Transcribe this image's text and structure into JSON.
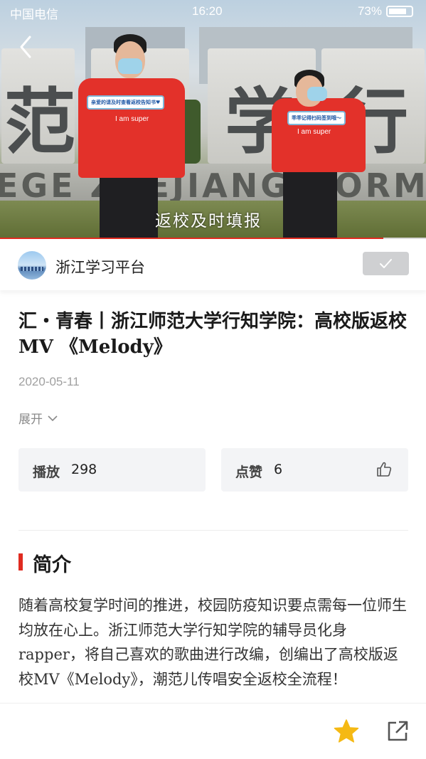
{
  "status_bar": {
    "carrier": "中国电信",
    "time": "16:20",
    "battery": "73%",
    "battery_level": 0.73
  },
  "video": {
    "caption": "返校及时填报",
    "plinth_text": "EGE ZHEJIANG NORMAL",
    "stone_glyphs": [
      "范",
      "学",
      "行"
    ],
    "person1_shirt": "I am super",
    "person1_sign": "亲爱的请及时查看返校告知书♥",
    "person2_shirt": "I am super",
    "person2_sign": "乖乖记得扫码签到哦～",
    "progress": 0.9
  },
  "channel": {
    "name": "浙江学习平台"
  },
  "article": {
    "title": "汇・青春丨浙江师范大学行知学院：高校版返校MV 《Melody》",
    "date": "2020-05-11",
    "expand_label": "展开",
    "plays_label": "播放",
    "plays_value": "298",
    "likes_label": "点赞",
    "likes_value": "6"
  },
  "intro": {
    "heading": "简介",
    "body": "随着高校复学时间的推进，校园防疫知识要点需每一位师生均放在心上。浙江师范大学行知学院的辅导员化身rapper，将自己喜欢的歌曲进行改编，创编出了高校版返校MV《Melody》，潮范儿传唱安全返校全流程！"
  },
  "colors": {
    "accent_red": "#e02b20",
    "star_yellow": "#f5b914",
    "stat_bg": "#f3f4f6"
  },
  "icons": [
    "back-arrow-icon",
    "wifi-icon",
    "battery-icon",
    "checkmark-icon",
    "chevron-down-icon",
    "thumbs-up-icon",
    "star-icon",
    "share-icon"
  ]
}
